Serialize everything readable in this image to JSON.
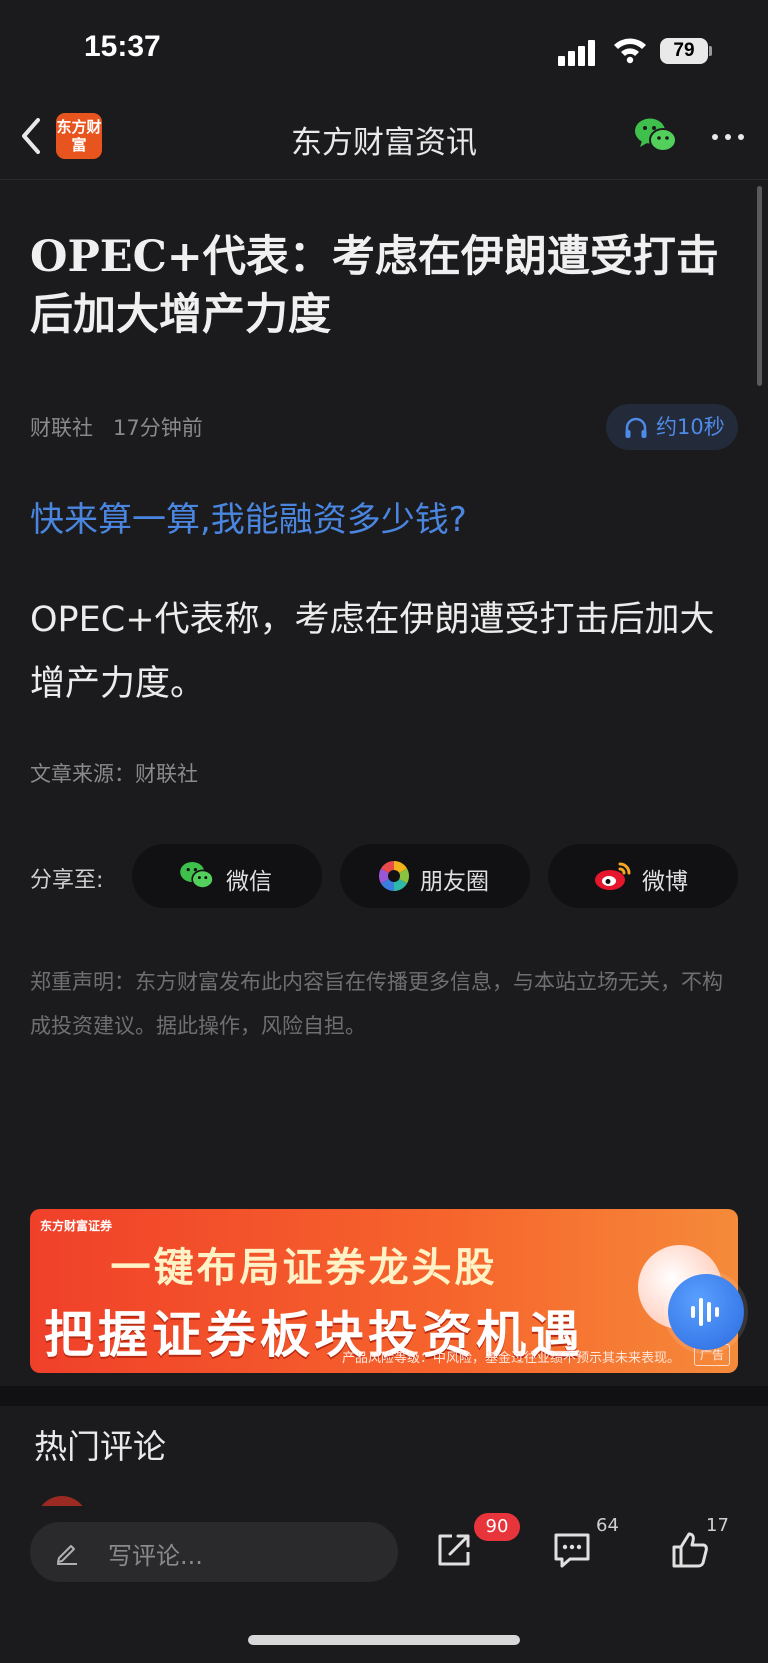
{
  "status_bar": {
    "time": "15:37",
    "battery": "79"
  },
  "nav": {
    "logo_text": "东方财富",
    "title": "东方财富资讯"
  },
  "article": {
    "title": "OPEC+代表：考虑在伊朗遭受打击后加大增产力度",
    "source_name": "财联社",
    "time_ago": "17分钟前",
    "audio_label": "约10秒",
    "promo_link": "快来算一算,我能融资多少钱?",
    "body": "OPEC+代表称，考虑在伊朗遭受打击后加大增产力度。",
    "source_line": "文章来源：财联社"
  },
  "share": {
    "label": "分享至:",
    "wechat": "微信",
    "moments": "朋友圈",
    "weibo": "微博"
  },
  "disclaimer": "郑重声明：东方财富发布此内容旨在传播更多信息，与本站立场无关，不构成投资建议。据此操作，风险自担。",
  "ad": {
    "brand": "东方财富证券",
    "line1": "一键布局证券龙头股",
    "line2": "把握证券板块投资机遇",
    "risk_note": "产品风险等级：中风险，基金过往业绩不预示其未来表现。",
    "tag": "广告"
  },
  "comments": {
    "title": "热门评论"
  },
  "bottom_bar": {
    "input_placeholder": "写评论...",
    "share_count": "90",
    "comment_count": "64",
    "like_count": "17"
  },
  "colors": {
    "background": "#1b1b1d",
    "accent_blue": "#4a86e0",
    "brand_orange": "#e8541e",
    "badge_red": "#e8343b"
  }
}
